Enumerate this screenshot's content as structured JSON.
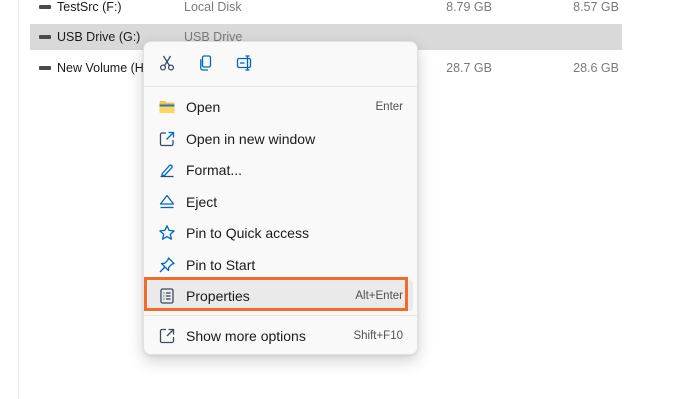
{
  "drives": [
    {
      "name": "TestSrc (F:)",
      "type": "Local Disk",
      "free": "8.79 GB",
      "total": "8.57 GB",
      "selected": false
    },
    {
      "name": "USB Drive (G:)",
      "type": "USB Drive",
      "free": "",
      "total": "",
      "selected": true
    },
    {
      "name": "New Volume (H:)",
      "type": "",
      "free": "28.7 GB",
      "total": "28.6 GB",
      "selected": false
    }
  ],
  "context_menu": {
    "quick_actions": [
      {
        "icon": "cut-icon"
      },
      {
        "icon": "copy-icon"
      },
      {
        "icon": "rename-icon"
      }
    ],
    "items": [
      {
        "label": "Open",
        "shortcut": "Enter",
        "icon": "folder-icon"
      },
      {
        "label": "Open in new window",
        "shortcut": "",
        "icon": "open-new-window-icon"
      },
      {
        "label": "Format...",
        "shortcut": "",
        "icon": "format-icon"
      },
      {
        "label": "Eject",
        "shortcut": "",
        "icon": "eject-icon"
      },
      {
        "label": "Pin to Quick access",
        "shortcut": "",
        "icon": "star-icon"
      },
      {
        "label": "Pin to Start",
        "shortcut": "",
        "icon": "pin-icon"
      },
      {
        "label": "Properties",
        "shortcut": "Alt+Enter",
        "icon": "properties-icon"
      },
      {
        "label": "Show more options",
        "shortcut": "Shift+F10",
        "icon": "show-more-icon"
      }
    ]
  },
  "colors": {
    "accent": "#0067c0",
    "highlight_border": "#f26b2b",
    "selected_row": "#d9d9d9",
    "folder_yellow": "#f8c23a"
  }
}
